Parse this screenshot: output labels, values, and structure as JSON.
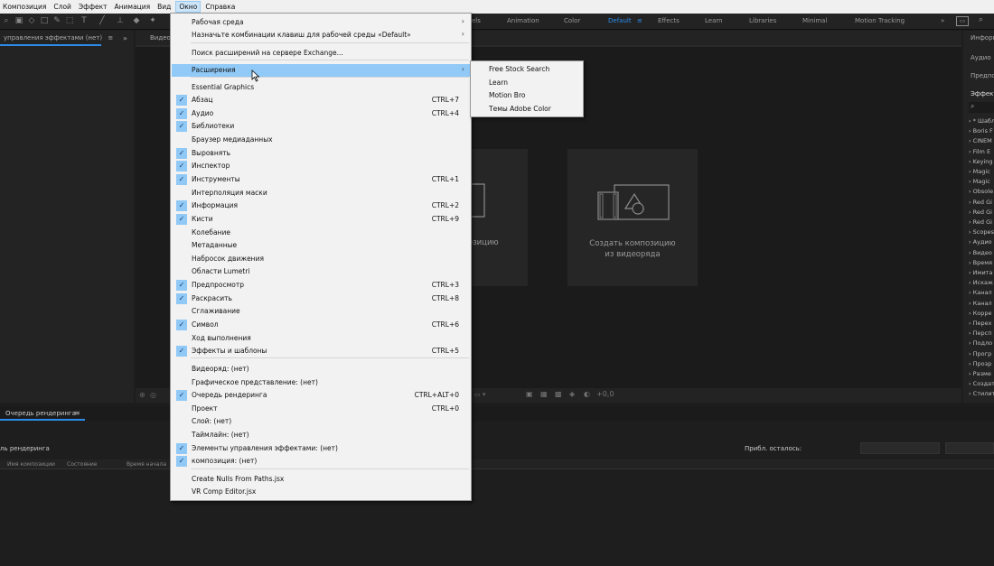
{
  "menubar": {
    "items": [
      "Композиция",
      "Слой",
      "Эффект",
      "Анимация",
      "Вид",
      "Окно",
      "Справка"
    ]
  },
  "workspaces": {
    "tabs": [
      "els",
      "Animation",
      "Color",
      "Default",
      "Effects",
      "Learn",
      "Libraries",
      "Minimal",
      "Motion Tracking"
    ],
    "active": "Default"
  },
  "left_panel": {
    "title": "управления эффектами (нет)"
  },
  "viewer_panel": {
    "title": "Видео"
  },
  "comp_cards": {
    "left_label": "позицию",
    "right_label_line1": "Создать композицию",
    "right_label_line2": "из видеоряда"
  },
  "right_panel": {
    "items": [
      "Информ",
      "Аудио",
      "Предпо",
      "Эффект"
    ],
    "effects": [
      "* Шабл",
      "Boris F",
      "CINEM",
      "Film E",
      "Keying",
      "Magic",
      "Magic",
      "Obsole",
      "Red Gi",
      "Red Gi",
      "Red Gi",
      "Scopes",
      "Аудио",
      "Видео",
      "Время",
      "Имита",
      "Искаж",
      "Канал",
      "Канал",
      "Корре",
      "Перех",
      "Персп",
      "Подло",
      "Прогр",
      "Прозр",
      "Разме",
      "Создат",
      "Стилит"
    ]
  },
  "bottom_panel": {
    "tab": "Очередь рендеринга",
    "render_label": "ль рендеринга",
    "remaining": "Прибл. осталось:",
    "columns": [
      "Имя композиции",
      "Состояние",
      "Время начала"
    ],
    "status_value": "+0,0"
  },
  "window_menu": {
    "items": [
      {
        "label": "Рабочая среда",
        "shortcut": "",
        "checked": false,
        "submenu": true
      },
      {
        "label": "Назначьте комбинации клавиш для рабочей среды «Default»",
        "shortcut": "",
        "checked": false,
        "submenu": true
      },
      {
        "label": "Поиск расширений на сервере Exchange...",
        "shortcut": "",
        "checked": false,
        "submenu": false
      },
      {
        "label": "Расширения",
        "shortcut": "",
        "checked": false,
        "submenu": true,
        "highlight": true
      },
      {
        "label": "Essential Graphics",
        "shortcut": "",
        "checked": false
      },
      {
        "label": "Абзац",
        "shortcut": "CTRL+7",
        "checked": true
      },
      {
        "label": "Аудио",
        "shortcut": "CTRL+4",
        "checked": true
      },
      {
        "label": "Библиотеки",
        "shortcut": "",
        "checked": true
      },
      {
        "label": "Браузер медиаданных",
        "shortcut": "",
        "checked": false
      },
      {
        "label": "Выровнять",
        "shortcut": "",
        "checked": true
      },
      {
        "label": "Инспектор",
        "shortcut": "",
        "checked": true
      },
      {
        "label": "Инструменты",
        "shortcut": "CTRL+1",
        "checked": true
      },
      {
        "label": "Интерполяция маски",
        "shortcut": "",
        "checked": false
      },
      {
        "label": "Информация",
        "shortcut": "CTRL+2",
        "checked": true
      },
      {
        "label": "Кисти",
        "shortcut": "CTRL+9",
        "checked": true
      },
      {
        "label": "Колебание",
        "shortcut": "",
        "checked": false
      },
      {
        "label": "Метаданные",
        "shortcut": "",
        "checked": false
      },
      {
        "label": "Набросок движения",
        "shortcut": "",
        "checked": false
      },
      {
        "label": "Области Lumetri",
        "shortcut": "",
        "checked": false
      },
      {
        "label": "Предпросмотр",
        "shortcut": "CTRL+3",
        "checked": true
      },
      {
        "label": "Раскрасить",
        "shortcut": "CTRL+8",
        "checked": true
      },
      {
        "label": "Сглаживание",
        "shortcut": "",
        "checked": false
      },
      {
        "label": "Символ",
        "shortcut": "CTRL+6",
        "checked": true
      },
      {
        "label": "Ход выполнения",
        "shortcut": "",
        "checked": false
      },
      {
        "label": "Эффекты и шаблоны",
        "shortcut": "CTRL+5",
        "checked": true
      },
      {
        "label": "Видеоряд: (нет)",
        "shortcut": "",
        "checked": false
      },
      {
        "label": "Графическое представление: (нет)",
        "shortcut": "",
        "checked": false
      },
      {
        "label": "Очередь рендеринга",
        "shortcut": "CTRL+ALT+0",
        "checked": true
      },
      {
        "label": "Проект",
        "shortcut": "CTRL+0",
        "checked": false
      },
      {
        "label": "Слой: (нет)",
        "shortcut": "",
        "checked": false
      },
      {
        "label": "Таймлайн: (нет)",
        "shortcut": "",
        "checked": false
      },
      {
        "label": "Элементы управления эффектами: (нет)",
        "shortcut": "",
        "checked": true
      },
      {
        "label": "композиция: (нет)",
        "shortcut": "",
        "checked": true
      },
      {
        "label": "Create Nulls From Paths.jsx",
        "shortcut": "",
        "checked": false
      },
      {
        "label": "VR Comp Editor.jsx",
        "shortcut": "",
        "checked": false
      }
    ]
  },
  "extensions_submenu": {
    "items": [
      "Free Stock Search",
      "Learn",
      "Motion Bro",
      "Темы Adobe Color"
    ]
  },
  "icons": {
    "check": "checkmark-icon",
    "submenu": "chevron-right-icon",
    "cursor": "mouse-cursor-icon"
  },
  "colors": {
    "accent": "#2d8ceb",
    "menu_highlight": "#91c9f7",
    "menu_bg": "#f2f2f2"
  }
}
